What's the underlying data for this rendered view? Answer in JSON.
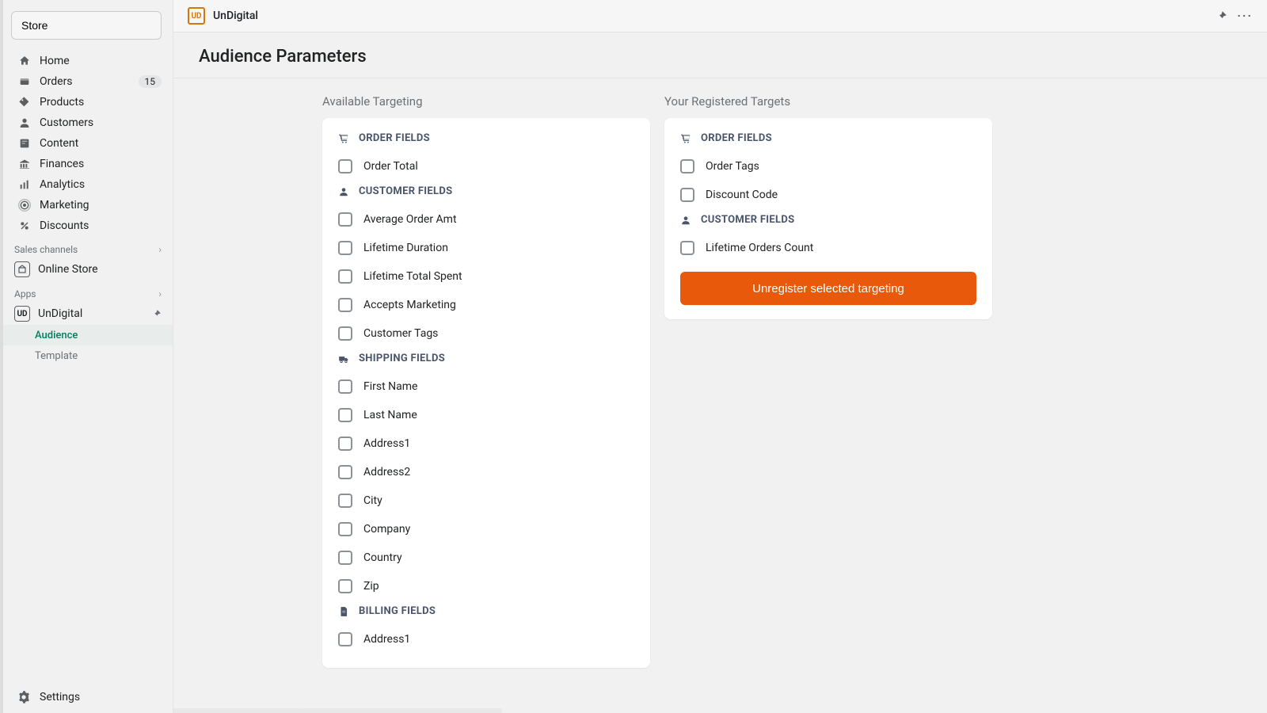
{
  "sidebar": {
    "store_label": "Store",
    "nav": [
      {
        "icon": "home",
        "label": "Home",
        "name": "home"
      },
      {
        "icon": "orders",
        "label": "Orders",
        "name": "orders",
        "badge": "15"
      },
      {
        "icon": "products",
        "label": "Products",
        "name": "products"
      },
      {
        "icon": "customers",
        "label": "Customers",
        "name": "customers"
      },
      {
        "icon": "content",
        "label": "Content",
        "name": "content"
      },
      {
        "icon": "finances",
        "label": "Finances",
        "name": "finances"
      },
      {
        "icon": "analytics",
        "label": "Analytics",
        "name": "analytics"
      },
      {
        "icon": "marketing",
        "label": "Marketing",
        "name": "marketing"
      },
      {
        "icon": "discounts",
        "label": "Discounts",
        "name": "discounts"
      }
    ],
    "sales_channels_label": "Sales channels",
    "online_store_label": "Online Store",
    "apps_label": "Apps",
    "app_name": "UnDigital",
    "subnav": [
      {
        "label": "Audience",
        "name": "audience",
        "active": true
      },
      {
        "label": "Template",
        "name": "template",
        "active": false
      }
    ],
    "settings_label": "Settings"
  },
  "header": {
    "brand": "UnDigital",
    "title": "Audience Parameters"
  },
  "available": {
    "title": "Available Targeting",
    "groups": [
      {
        "icon": "cart",
        "label": "ORDER FIELDS",
        "items": [
          "Order Total"
        ]
      },
      {
        "icon": "person",
        "label": "CUSTOMER FIELDS",
        "items": [
          "Average Order Amt",
          "Lifetime Duration",
          "Lifetime Total Spent",
          "Accepts Marketing",
          "Customer Tags"
        ]
      },
      {
        "icon": "truck",
        "label": "SHIPPING FIELDS",
        "items": [
          "First Name",
          "Last Name",
          "Address1",
          "Address2",
          "City",
          "Company",
          "Country",
          "Zip"
        ]
      },
      {
        "icon": "file",
        "label": "BILLING FIELDS",
        "items": [
          "Address1"
        ]
      }
    ]
  },
  "registered": {
    "title": "Your Registered Targets",
    "groups": [
      {
        "icon": "cart",
        "label": "ORDER FIELDS",
        "items": [
          "Order Tags",
          "Discount Code"
        ]
      },
      {
        "icon": "person",
        "label": "CUSTOMER FIELDS",
        "items": [
          "Lifetime Orders Count"
        ]
      }
    ],
    "action_label": "Unregister selected targeting"
  }
}
